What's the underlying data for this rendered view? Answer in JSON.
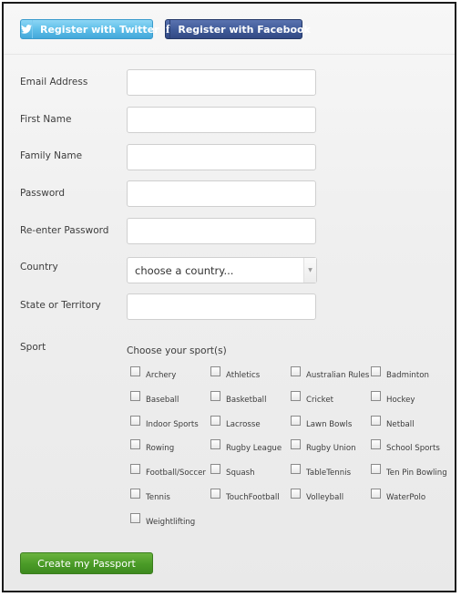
{
  "social": {
    "twitter_label": "Register with Twitter",
    "facebook_label": "Register with Facebook",
    "twitter_color": "#5fbfe9",
    "facebook_color": "#3f5a98"
  },
  "form": {
    "email_label": "Email Address",
    "first_name_label": "First Name",
    "family_name_label": "Family Name",
    "password_label": "Password",
    "reenter_password_label": "Re-enter Password",
    "country_label": "Country",
    "country_value": "choose a country...",
    "state_label": "State or Territory",
    "sport_label": "Sport",
    "sport_heading": "Choose your sport(s)"
  },
  "sports": [
    "Archery",
    "Athletics",
    "Australian Rules",
    "Badminton",
    "Baseball",
    "Basketball",
    "Cricket",
    "Hockey",
    "Indoor Sports",
    "Lacrosse",
    "Lawn Bowls",
    "Netball",
    "Rowing",
    "Rugby League",
    "Rugby Union",
    "School Sports",
    "Football/Soccer",
    "Squash",
    "TableTennis",
    "Ten Pin Bowling",
    "Tennis",
    "TouchFootball",
    "Volleyball",
    "WaterPolo",
    "Weightlifting"
  ],
  "submit_label": "Create my Passport",
  "submit_color": "#4a9b27"
}
